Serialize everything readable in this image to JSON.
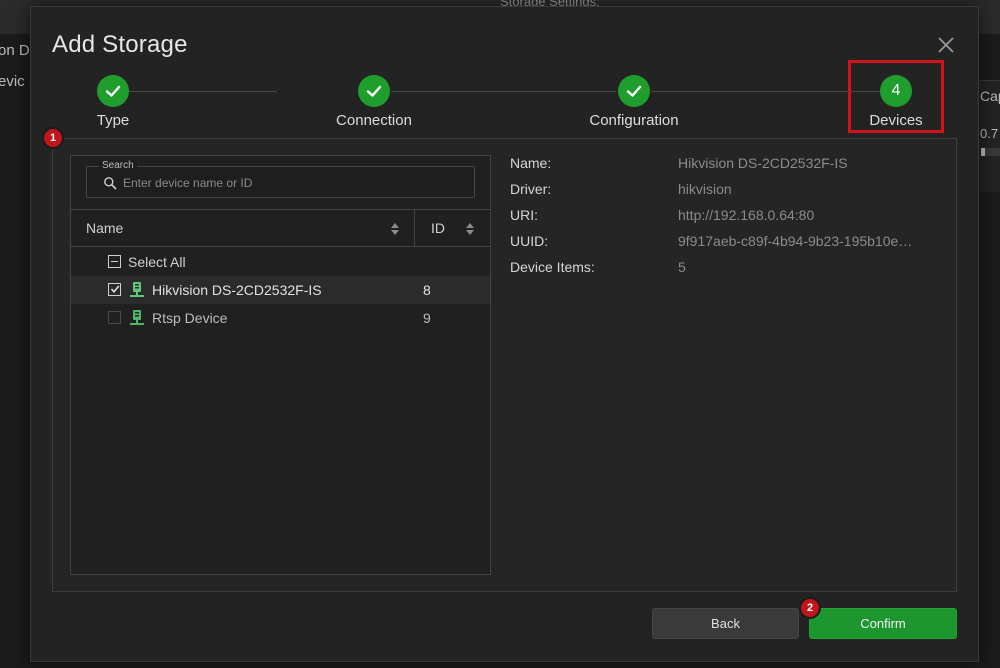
{
  "background": {
    "title_fragment": "Storage Settings:",
    "left_fragment_1": "on D",
    "left_fragment_2": "evic",
    "right_header_fragment": "Cap",
    "right_value_fragment": "0.7"
  },
  "dialog": {
    "title": "Add Storage",
    "close_icon": "close-icon"
  },
  "stepper": {
    "steps": [
      {
        "label": "Type",
        "state": "done",
        "icon": "check-icon"
      },
      {
        "label": "Connection",
        "state": "done",
        "icon": "check-icon"
      },
      {
        "label": "Configuration",
        "state": "done",
        "icon": "check-icon"
      },
      {
        "label": "Devices",
        "state": "current",
        "number": "4"
      }
    ],
    "accent_color": "#1f9e2e",
    "highlight_color": "#d0141b"
  },
  "annotations": {
    "badge_1": "1",
    "badge_2": "2"
  },
  "device_list": {
    "search_legend": "Search",
    "search_placeholder": "Enter device name or ID",
    "search_value": "",
    "columns": {
      "name": "Name",
      "id": "ID"
    },
    "select_all_label": "Select All",
    "rows": [
      {
        "name": "Hikvision DS-2CD2532F-IS",
        "id": "8",
        "checked": true,
        "icon": "camera-device-icon"
      },
      {
        "name": "Rtsp Device",
        "id": "9",
        "checked": false,
        "icon": "camera-device-icon"
      }
    ]
  },
  "details": {
    "name_key": "Name:",
    "name_value": "Hikvision DS-2CD2532F-IS",
    "driver_key": "Driver:",
    "driver_value": "hikvision",
    "uri_key": "URI:",
    "uri_value": "http://192.168.0.64:80",
    "uuid_key": "UUID:",
    "uuid_value": "9f917aeb-c89f-4b94-9b23-195b10e…",
    "items_key": "Device Items:",
    "items_value": "5"
  },
  "footer": {
    "back_label": "Back",
    "confirm_label": "Confirm"
  }
}
